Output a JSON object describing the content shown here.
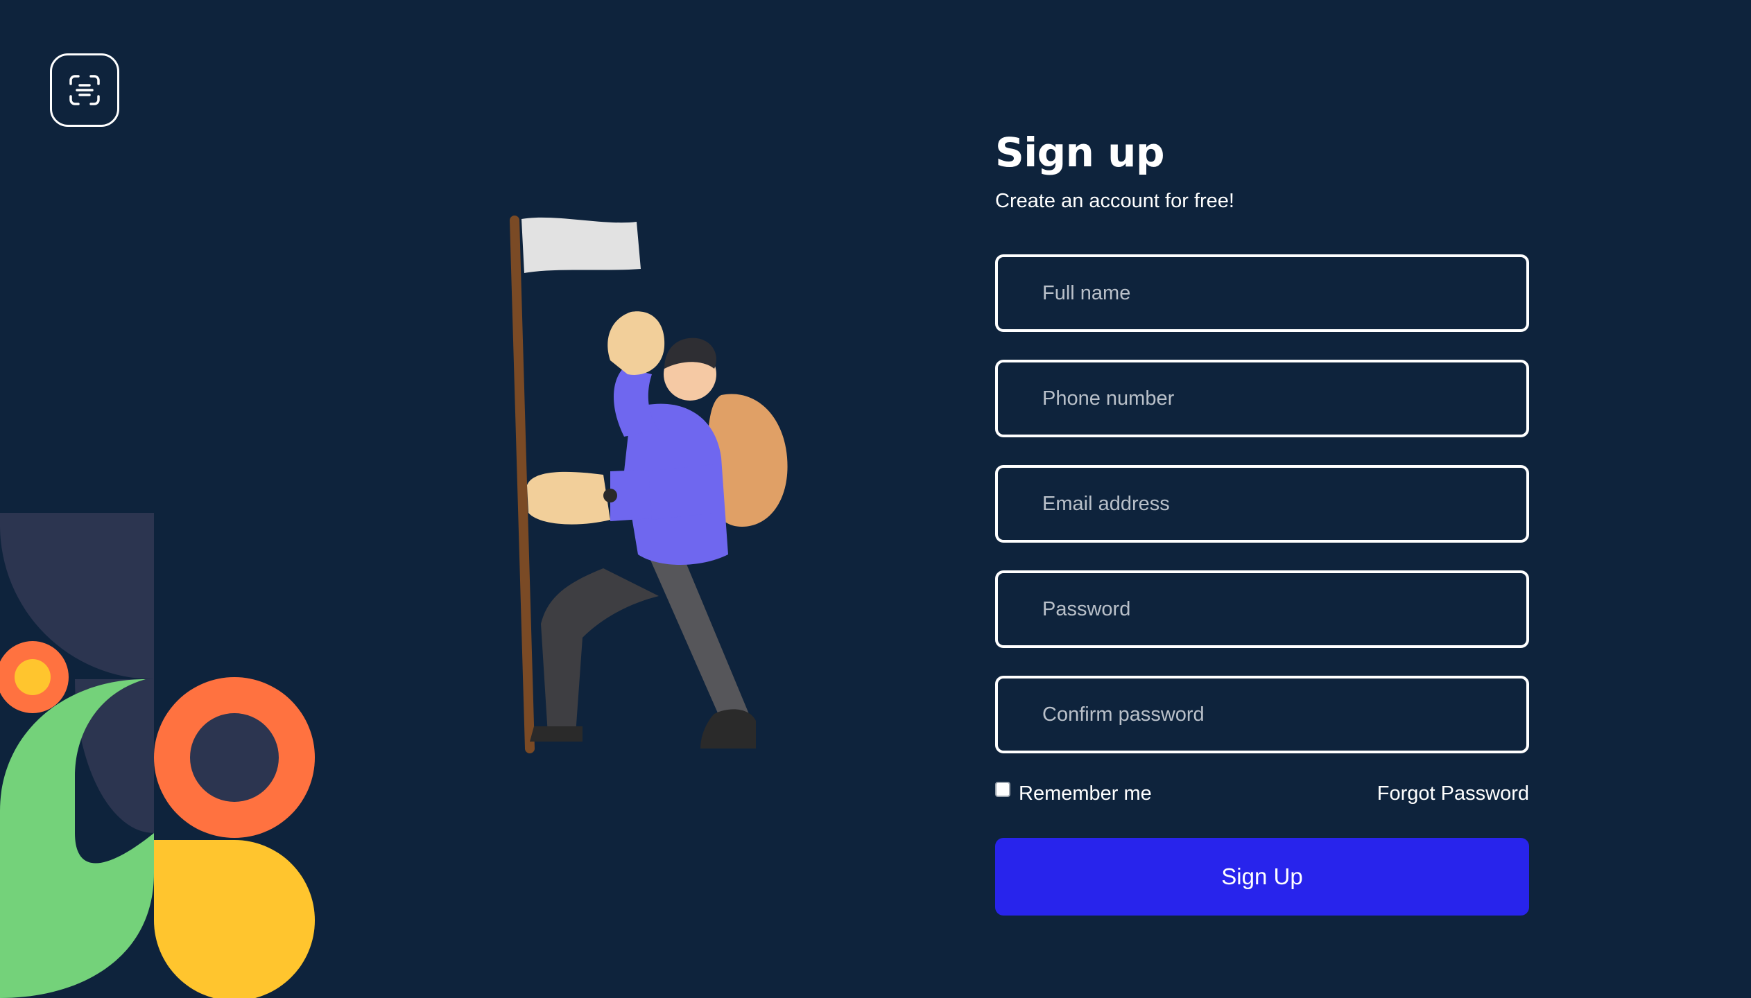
{
  "logo": {
    "icon": "scan-text-icon"
  },
  "form": {
    "title": "Sign up",
    "subtitle": "Create an account for free!",
    "fields": {
      "full_name_placeholder": "Full name",
      "phone_placeholder": "Phone number",
      "email_placeholder": "Email address",
      "password_placeholder": "Password",
      "confirm_password_placeholder": "Confirm password"
    },
    "remember_label": "Remember me",
    "forgot_label": "Forgot Password",
    "submit_label": "Sign Up"
  },
  "colors": {
    "background": "#0e233c",
    "primary_button": "#2824ec",
    "field_border": "#ffffff",
    "deco_orange": "#ff7240",
    "deco_yellow": "#ffc52e",
    "deco_green": "#74d27a",
    "deco_navy": "#2c3550"
  }
}
